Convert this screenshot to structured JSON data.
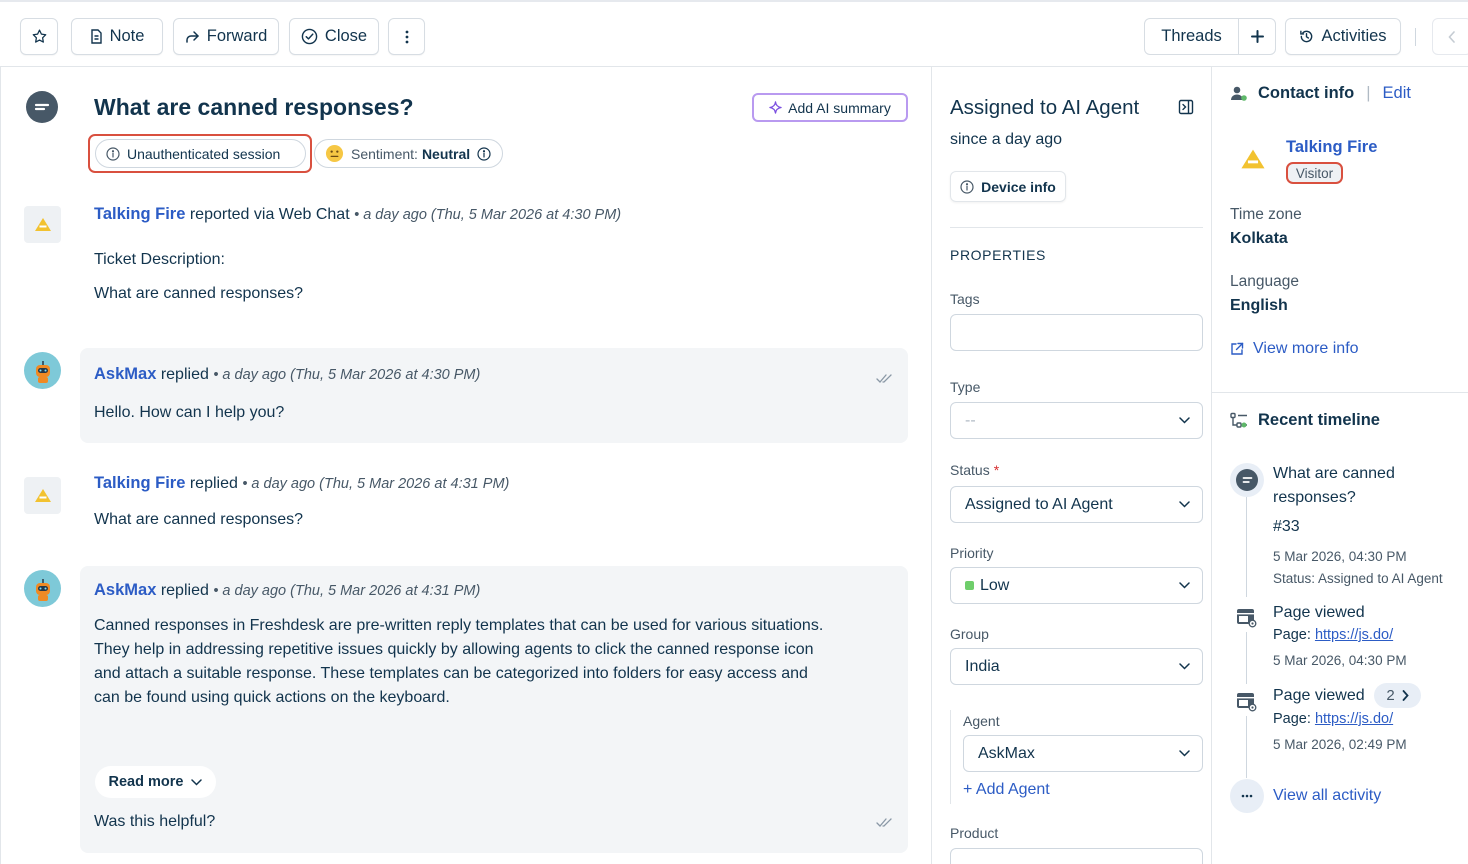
{
  "toolbar": {
    "note_label": "Note",
    "forward_label": "Forward",
    "close_label": "Close",
    "threads_label": "Threads",
    "activities_label": "Activities"
  },
  "ticket": {
    "title": "What are canned responses?",
    "ai_summary_label": "Add AI summary",
    "session_badge": "Unauthenticated session",
    "sentiment_label": "Sentiment:",
    "sentiment_value": "Neutral"
  },
  "messages": [
    {
      "author": "Talking Fire",
      "verb": "reported via Web Chat",
      "time": "• a day ago (Thu, 5 Mar 2026 at 4:30 PM)",
      "lines": [
        "Ticket Description:",
        "What are canned responses?"
      ]
    },
    {
      "author": "AskMax",
      "verb": "replied",
      "time": "• a day ago (Thu, 5 Mar 2026 at 4:30 PM)",
      "text": "Hello. How can I help you?"
    },
    {
      "author": "Talking Fire",
      "verb": "replied",
      "time": "• a day ago (Thu, 5 Mar 2026 at 4:31 PM)",
      "text": "What are canned responses?"
    },
    {
      "author": "AskMax",
      "verb": "replied",
      "time": "• a day ago (Thu, 5 Mar 2026 at 4:31 PM)",
      "lines": [
        "Canned responses in Freshdesk are pre-written reply templates that can be used for various situations.",
        "They help in addressing repetitive issues quickly by allowing agents to click the canned response icon",
        "and attach a suitable response. These templates can be categorized into folders for easy access and",
        "can be found using quick actions on the keyboard."
      ],
      "read_more": "Read more",
      "helpful": "Was this helpful?"
    }
  ],
  "properties": {
    "assigned_title": "Assigned to AI Agent",
    "since": "since a day ago",
    "device_info": "Device info",
    "section_title": "PROPERTIES",
    "tags_label": "Tags",
    "tags_value": "",
    "type_label": "Type",
    "type_value": "--",
    "status_label": "Status",
    "status_required": "*",
    "status_value": "Assigned to AI Agent",
    "priority_label": "Priority",
    "priority_value": "Low",
    "group_label": "Group",
    "group_value": "India",
    "agent_label": "Agent",
    "agent_value": "AskMax",
    "add_agent": "+ Add Agent",
    "product_label": "Product"
  },
  "contact": {
    "header": "Contact info",
    "edit": "Edit",
    "name": "Talking Fire",
    "tag": "Visitor",
    "timezone_label": "Time zone",
    "timezone_value": "Kolkata",
    "language_label": "Language",
    "language_value": "English",
    "view_more": "View more info"
  },
  "timeline": {
    "header": "Recent timeline",
    "items": [
      {
        "title_line1": "What are canned",
        "title_line2": "responses?",
        "id": "#33",
        "date": "5 Mar 2026, 04:30 PM",
        "status": "Status: Assigned to AI Agent"
      },
      {
        "title": "Page viewed",
        "page_label": "Page:",
        "page_link": "https://js.do/",
        "date": "5 Mar 2026, 04:30 PM"
      },
      {
        "title": "Page viewed",
        "count": "2",
        "page_label": "Page:",
        "page_link": "https://js.do/",
        "date": "5 Mar 2026, 02:49 PM"
      }
    ],
    "view_all": "View all activity"
  },
  "colors": {
    "link": "#2c5cc5",
    "text": "#12344d",
    "highlight": "#d9503f",
    "ai_border": "#b99af0",
    "priority_low": "#6fce6b"
  }
}
